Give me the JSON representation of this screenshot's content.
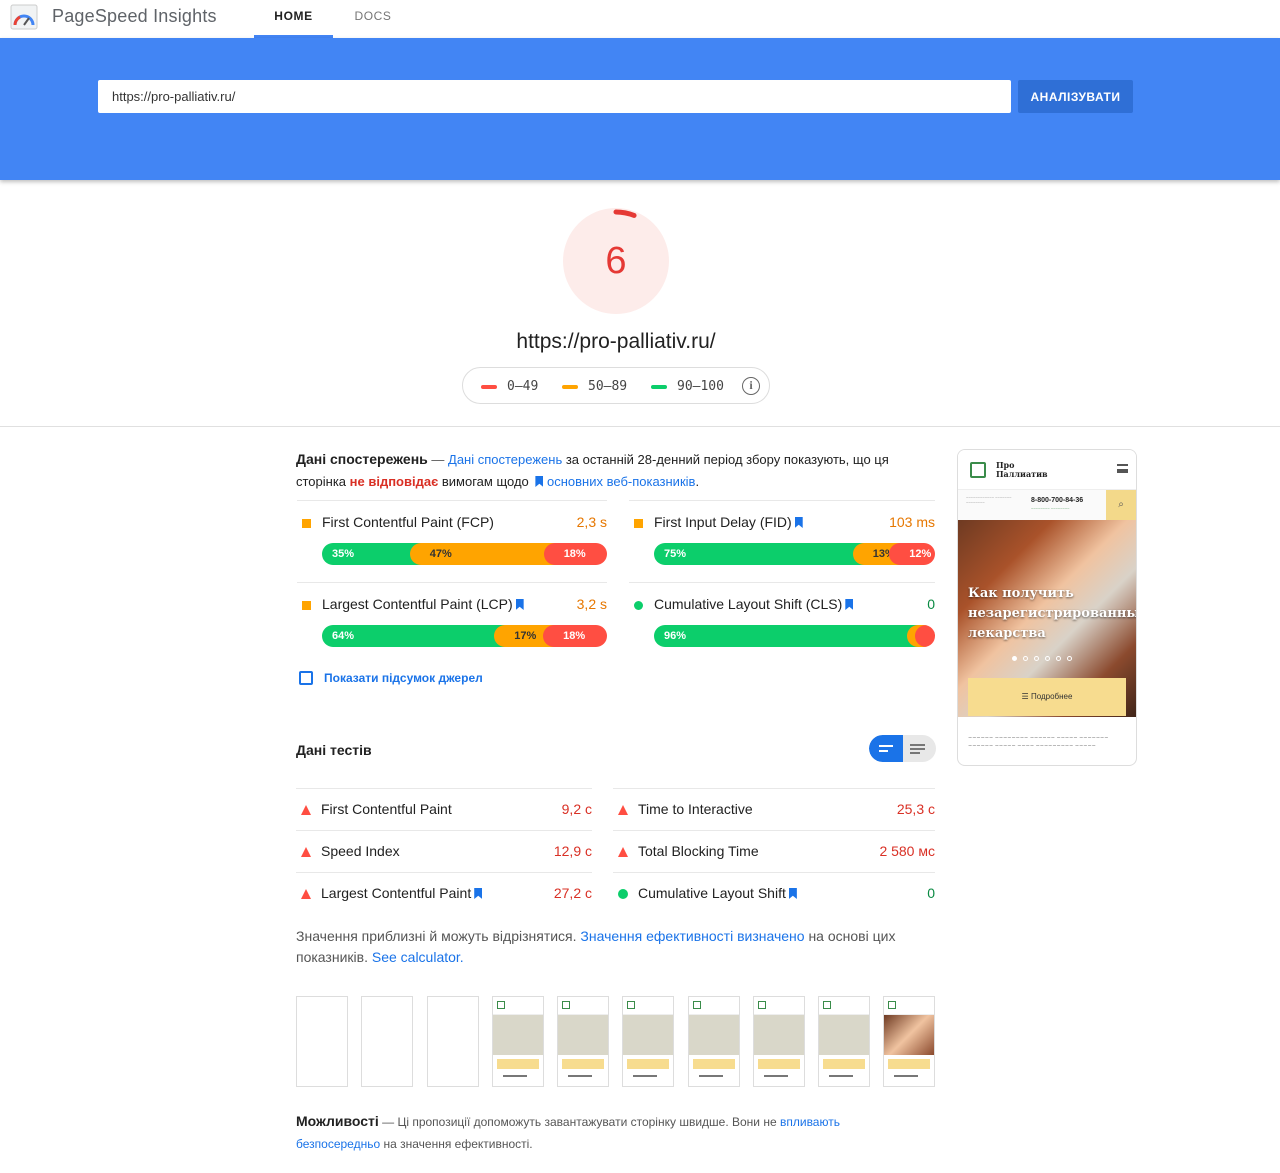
{
  "app": {
    "title": "PageSpeed Insights"
  },
  "nav": {
    "home": "HOME",
    "docs": "DOCS"
  },
  "search": {
    "url_value": "https://pro-palliativ.ru/",
    "analyze_label": "АНАЛІЗУВАТИ"
  },
  "score": {
    "value": "6",
    "value_fraction": 0.06,
    "color": "#e53935",
    "url": "https://pro-palliativ.ru/"
  },
  "legend": [
    {
      "label": "0–49",
      "color": "#ff4e42"
    },
    {
      "label": "50–89",
      "color": "#ffa400"
    },
    {
      "label": "90–100",
      "color": "#0cce6b"
    }
  ],
  "field": {
    "title": "Дані спостережень",
    "dash": " — ",
    "link1": "Дані спостережень",
    "text1": " за останній 28-денний період збору показують, що ця сторінка ",
    "fails": "не відповідає",
    "text2": " вимогам щодо ",
    "link2": "основних веб-показників",
    "text3": ".",
    "metrics": [
      {
        "name": "First Contentful Paint (FCP)",
        "value": "2,3 s",
        "status": "average",
        "bookmark": false,
        "dist": [
          "35%",
          "47%",
          "18%"
        ],
        "dist_fraction": [
          0.35,
          0.47,
          0.18
        ]
      },
      {
        "name": "First Input Delay (FID)",
        "value": "103 ms",
        "status": "average",
        "bookmark": true,
        "dist": [
          "75%",
          "13%",
          "12%"
        ],
        "dist_fraction": [
          0.75,
          0.13,
          0.12
        ]
      },
      {
        "name": "Largest Contentful Paint (LCP)",
        "value": "3,2 s",
        "status": "average",
        "bookmark": true,
        "dist": [
          "64%",
          "17%",
          "18%"
        ],
        "dist_fraction": [
          0.64,
          0.17,
          0.18
        ]
      },
      {
        "name": "Cumulative Layout Shift (CLS)",
        "value": "0",
        "status": "good",
        "bookmark": true,
        "dist": [
          "96%",
          "2%",
          "2%"
        ],
        "dist_fraction": [
          0.96,
          0.02,
          0.02
        ]
      }
    ],
    "show_sources": "Показати підсумок джерел"
  },
  "preview": {
    "brand_line1": "Про",
    "brand_line2": "Паллиатив",
    "phone": "8-800-700-84-36",
    "headline": "Как получить незарегистрированные лекарства",
    "cta": "☰ Подробнее"
  },
  "lab": {
    "title": "Дані тестів",
    "metrics": [
      {
        "name": "First Contentful Paint",
        "value": "9,2 с",
        "status": "poor",
        "bookmark": false
      },
      {
        "name": "Time to Interactive",
        "value": "25,3 с",
        "status": "poor",
        "bookmark": false
      },
      {
        "name": "Speed Index",
        "value": "12,9 с",
        "status": "poor",
        "bookmark": false
      },
      {
        "name": "Total Blocking Time",
        "value": "2 580 мс",
        "status": "poor",
        "bookmark": false
      },
      {
        "name": "Largest Contentful Paint",
        "value": "27,2 с",
        "status": "poor",
        "bookmark": true
      },
      {
        "name": "Cumulative Layout Shift",
        "value": "0",
        "status": "good",
        "bookmark": true
      }
    ],
    "note1": "Значення приблизні й можуть відрізнятися. ",
    "note_link": "Значення ефективності визначено",
    "note2": " на основі цих показників. ",
    "note_link2": "See calculator."
  },
  "opportunities": {
    "title": "Можливості",
    "text1": " — Ці пропозиції допоможуть завантажувати сторінку швидше. Вони не ",
    "link": "впливають безпосередньо",
    "text2": " на значення ефективності."
  },
  "colors": {
    "good": "#0cce6b",
    "average": "#ffa400",
    "poor": "#ff4e42",
    "accent": "#4285f4"
  }
}
